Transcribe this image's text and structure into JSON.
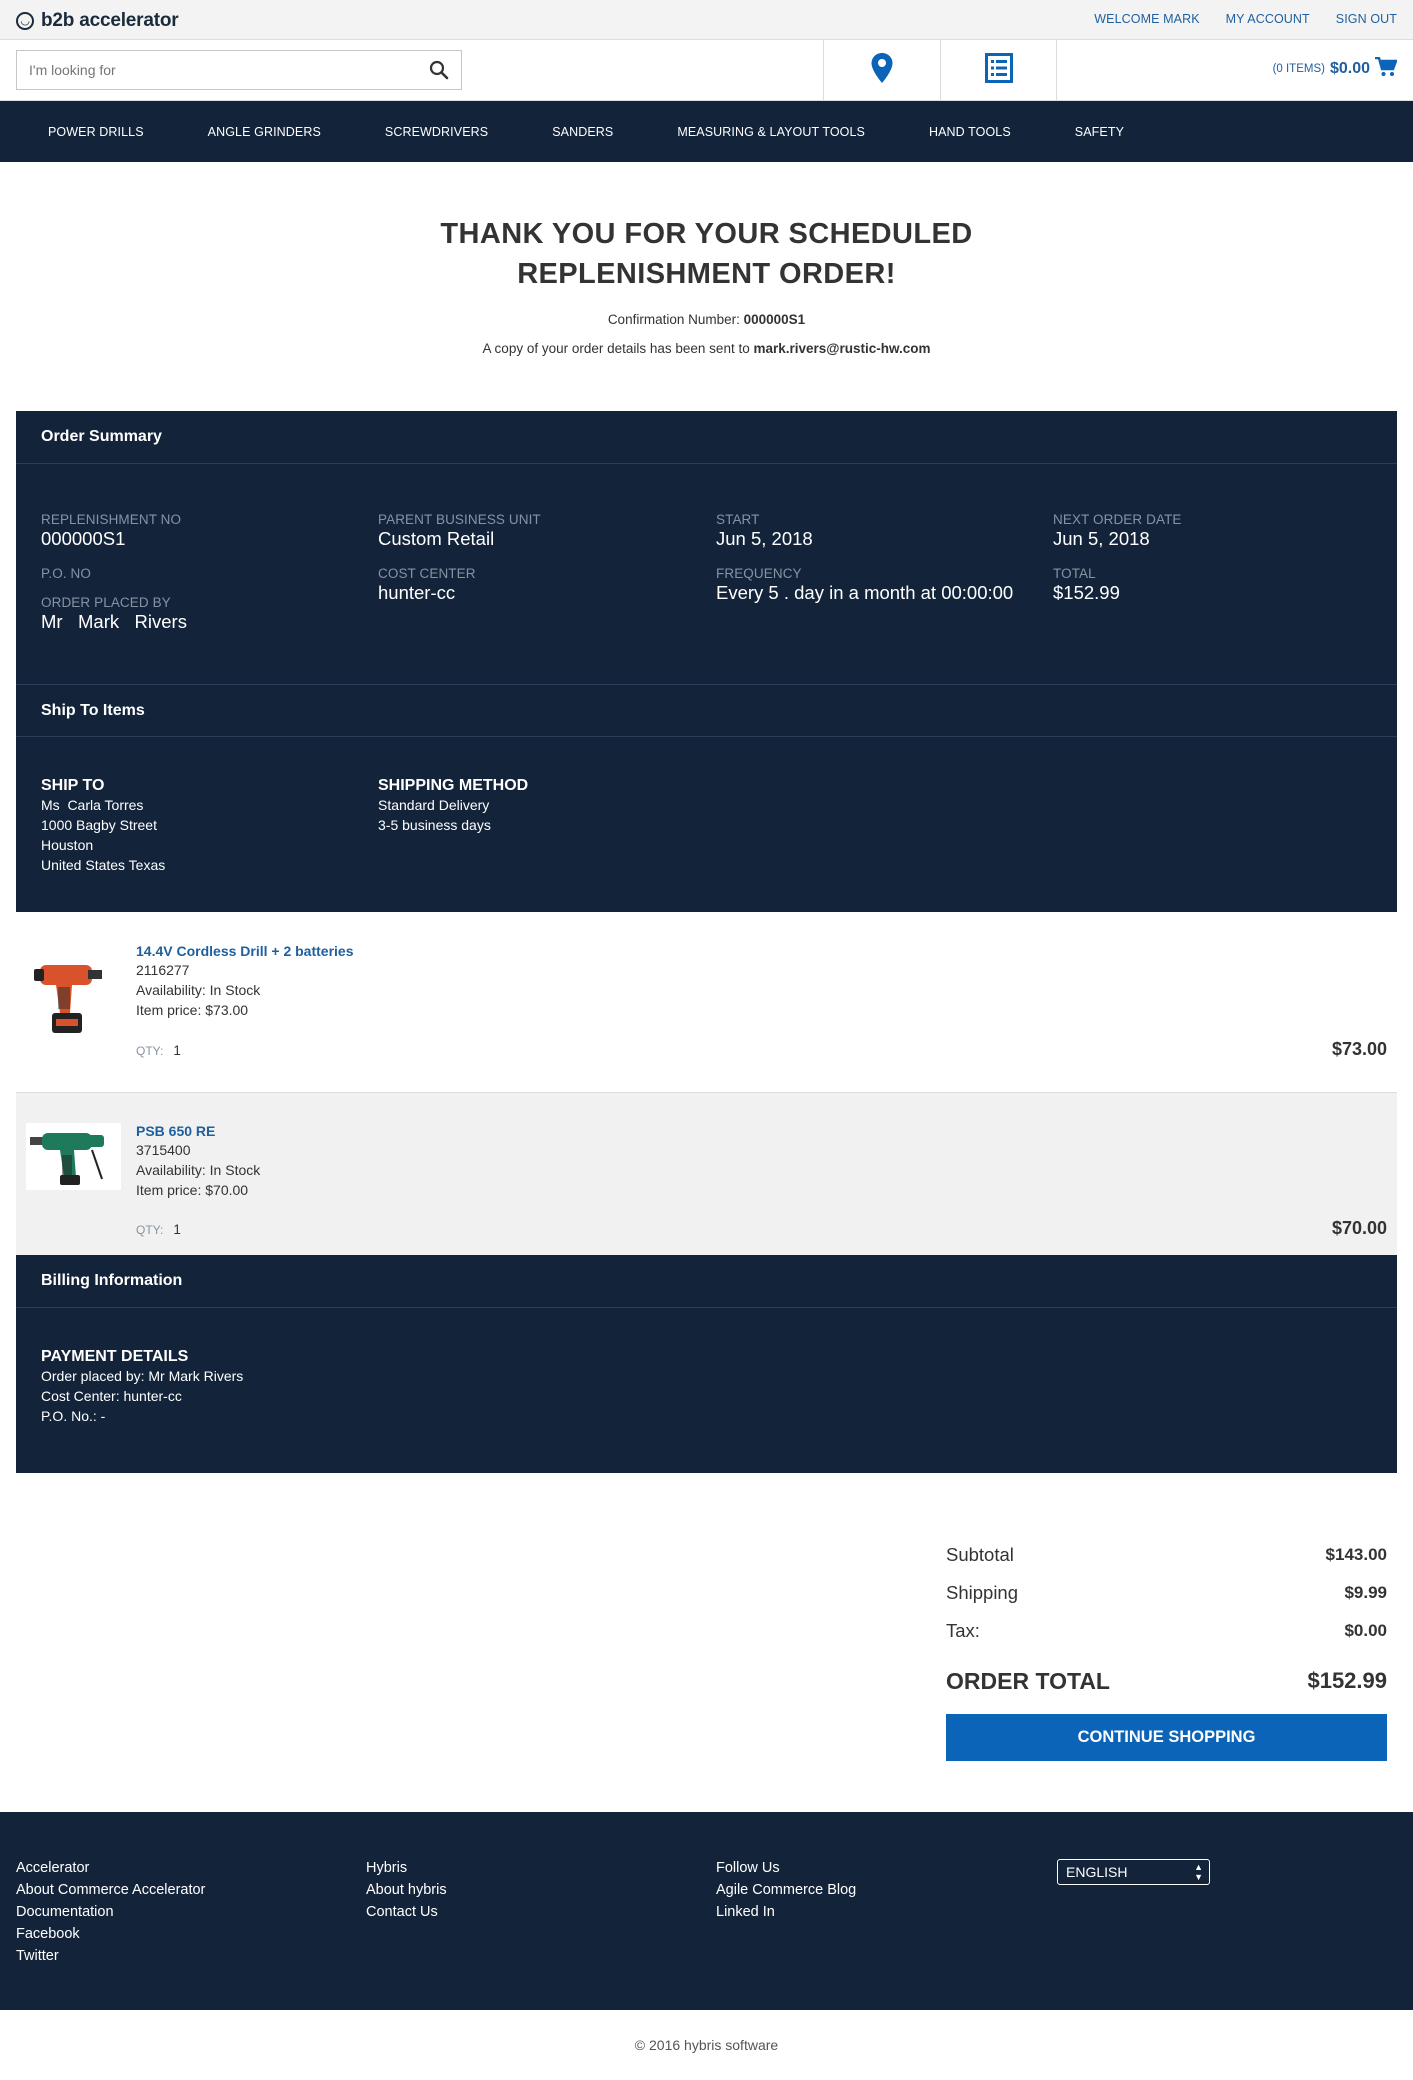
{
  "header": {
    "logo_text": "b2b accelerator",
    "links": [
      "WELCOME MARK",
      "MY ACCOUNT",
      "SIGN OUT"
    ],
    "search_placeholder": "I'm looking for",
    "cart_items": "(0 ITEMS)",
    "cart_amount": "$0.00",
    "icons": {
      "search": "search-icon",
      "location": "location-pin-icon",
      "orders": "order-list-icon",
      "cart": "cart-icon"
    }
  },
  "nav": [
    "POWER DRILLS",
    "ANGLE GRINDERS",
    "SCREWDRIVERS",
    "SANDERS",
    "MEASURING & LAYOUT TOOLS",
    "HAND TOOLS",
    "SAFETY"
  ],
  "thanks": {
    "title_line1": "THANK YOU FOR YOUR SCHEDULED",
    "title_line2": "REPLENISHMENT ORDER!",
    "confirmation_label": "Confirmation Number: ",
    "confirmation_number": "000000S1",
    "copy_text": "A copy of your order details has been sent to ",
    "email": "mark.rivers@rustic-hw.com"
  },
  "summary": {
    "title": "Order Summary",
    "replenishment_no_label": "REPLENISHMENT NO",
    "replenishment_no": "000000S1",
    "po_no_label": "P.O. NO",
    "order_placed_by_label": "ORDER PLACED BY",
    "order_placed_by": "Mr   Mark   Rivers",
    "parent_unit_label": "PARENT BUSINESS UNIT",
    "parent_unit": "Custom Retail",
    "cost_center_label": "COST CENTER",
    "cost_center": "hunter-cc",
    "start_label": "START",
    "start": "Jun 5, 2018",
    "frequency_label": "FREQUENCY",
    "frequency": "Every 5 . day in a month at 00:00:00",
    "next_order_label": "NEXT ORDER DATE",
    "next_order": "Jun 5, 2018",
    "total_label": "TOTAL",
    "total": "$152.99"
  },
  "ship": {
    "title": "Ship To Items",
    "ship_to_label": "SHIP TO",
    "ship_to_lines": [
      "Ms  Carla Torres",
      "1000 Bagby Street",
      "Houston",
      "United States Texas"
    ],
    "method_label": "SHIPPING METHOD",
    "method_lines": [
      "Standard Delivery",
      "3-5 business days"
    ]
  },
  "items": [
    {
      "name": "14.4V Cordless Drill + 2 batteries",
      "sku": "2116277",
      "availability": "Availability: In Stock",
      "price": "Item price: $73.00",
      "qty_label": "QTY:",
      "qty": "1",
      "total": "$73.00"
    },
    {
      "name": "PSB 650 RE",
      "sku": "3715400",
      "availability": "Availability: In Stock",
      "price": "Item price: $70.00",
      "qty_label": "QTY:",
      "qty": "1",
      "total": "$70.00"
    }
  ],
  "billing": {
    "title": "Billing Information",
    "payment_label": "PAYMENT DETAILS",
    "lines": [
      "Order placed by: Mr Mark Rivers",
      "Cost Center: hunter-cc",
      "P.O. No.: -"
    ]
  },
  "totals": {
    "subtotal_label": "Subtotal",
    "subtotal": "$143.00",
    "shipping_label": "Shipping",
    "shipping": "$9.99",
    "tax_label": "Tax:",
    "tax": "$0.00",
    "order_total_label": "ORDER TOTAL",
    "order_total": "$152.99",
    "continue_label": "CONTINUE SHOPPING"
  },
  "footer": {
    "col1": [
      "Accelerator",
      "About Commerce Accelerator",
      "Documentation",
      "Facebook",
      "Twitter"
    ],
    "col2": [
      "Hybris",
      "About hybris",
      "Contact Us"
    ],
    "col3": [
      "Follow Us",
      "Agile Commerce Blog",
      "Linked In"
    ],
    "language": "ENGLISH",
    "copyright": "© 2016 hybris software"
  }
}
